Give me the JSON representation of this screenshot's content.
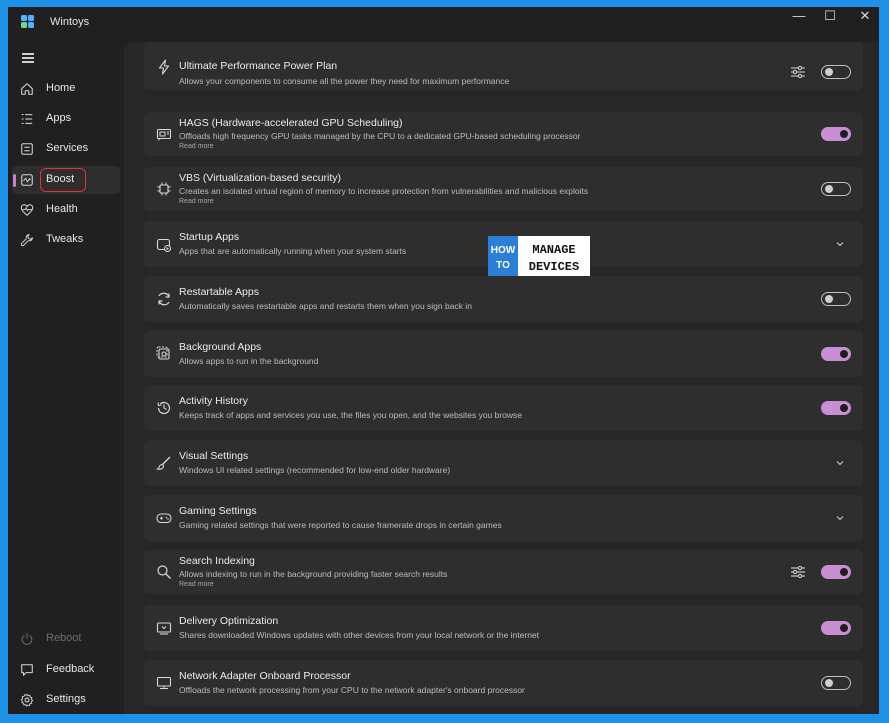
{
  "window": {
    "title": "Wintoys",
    "controls": {
      "minimize": "—",
      "maximize": "☐",
      "close": "✕"
    }
  },
  "sidebar": {
    "items": [
      {
        "id": "home",
        "label": "Home",
        "icon": "home-icon"
      },
      {
        "id": "apps",
        "label": "Apps",
        "icon": "list-icon"
      },
      {
        "id": "services",
        "label": "Services",
        "icon": "services-icon"
      },
      {
        "id": "boost",
        "label": "Boost",
        "icon": "boost-icon",
        "active": true
      },
      {
        "id": "health",
        "label": "Health",
        "icon": "heart-pulse-icon"
      },
      {
        "id": "tweaks",
        "label": "Tweaks",
        "icon": "wrench-icon"
      }
    ],
    "bottom": [
      {
        "id": "reboot",
        "label": "Reboot",
        "icon": "power-icon",
        "disabled": true
      },
      {
        "id": "feedback",
        "label": "Feedback",
        "icon": "feedback-icon"
      },
      {
        "id": "settings",
        "label": "Settings",
        "icon": "gear-icon"
      }
    ]
  },
  "watermark": {
    "line1": "HOW",
    "line2": "TO",
    "line3": "MANAGE",
    "line4": "DEVICES"
  },
  "accent_color": "#c98fd4",
  "settings": [
    {
      "title": "Ultimate Performance Power Plan",
      "desc": "Allows your components to consume all the power they need for maximum performance",
      "toggle": "off",
      "tune": true
    },
    {
      "title": "HAGS (Hardware-accelerated GPU Scheduling)",
      "desc": "Offloads high frequency GPU tasks managed by the CPU to a dedicated GPU-based scheduling processor",
      "more": "Read more",
      "toggle": "on"
    },
    {
      "title": "VBS (Virtualization-based security)",
      "desc": "Creates an isolated virtual region of memory to increase protection from vulnerabilities and malicious exploits",
      "more": "Read more",
      "toggle": "off"
    },
    {
      "title": "Startup Apps",
      "desc": "Apps that are automatically running when your system starts",
      "expand": true
    },
    {
      "title": "Restartable Apps",
      "desc": "Automatically saves restartable apps and restarts them when you sign back in",
      "toggle": "off"
    },
    {
      "title": "Background Apps",
      "desc": "Allows apps to run in the background",
      "toggle": "on"
    },
    {
      "title": "Activity History",
      "desc": "Keeps track of apps and services you use, the files you open, and the websites you browse",
      "toggle": "on"
    },
    {
      "title": "Visual Settings",
      "desc": "Windows UI related settings (recommended for low-end older hardware)",
      "expand": true
    },
    {
      "title": "Gaming Settings",
      "desc": "Gaming related settings that were reported to cause framerate drops in certain games",
      "expand": true
    },
    {
      "title": "Search Indexing",
      "desc": "Allows indexing to run in the background providing faster search results",
      "more": "Read more",
      "toggle": "on",
      "tune": true
    },
    {
      "title": "Delivery Optimization",
      "desc": "Shares downloaded Windows updates with other devices from your local network or the internet",
      "toggle": "on"
    },
    {
      "title": "Network Adapter Onboard Processor",
      "desc": "Offloads the network processing from your CPU to the network adapter's onboard processor",
      "toggle": "off"
    }
  ]
}
